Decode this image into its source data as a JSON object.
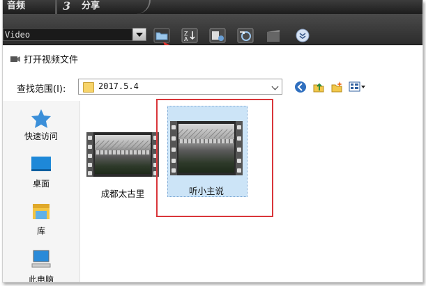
{
  "tabs": [
    {
      "label": "音频"
    },
    {
      "number": "3",
      "label": "分享"
    }
  ],
  "toolbar": {
    "media_type_value": "Video",
    "icons": [
      "open-folder-icon",
      "sort-icon",
      "view-options-icon",
      "refresh-icon",
      "clapper-icon",
      "expand-icon"
    ]
  },
  "dialog": {
    "title": "打开视频文件",
    "look_in_label": "查找范围(I):",
    "look_in_value": "2017.5.4"
  },
  "places": [
    {
      "label": "快速访问",
      "icon": "star-icon"
    },
    {
      "label": "桌面",
      "icon": "desktop-icon"
    },
    {
      "label": "库",
      "icon": "library-icon"
    },
    {
      "label": "此电脑",
      "icon": "computer-icon"
    }
  ],
  "files": [
    {
      "name": "成都太古里",
      "selected": false
    },
    {
      "name": "听小主说",
      "selected": true
    }
  ],
  "colors": {
    "highlight": "#d9363a",
    "selection": "#cce4f7",
    "arrow": "#e0332e"
  }
}
